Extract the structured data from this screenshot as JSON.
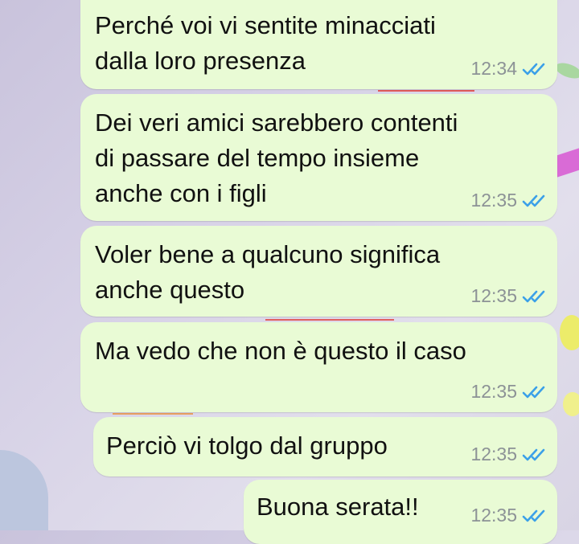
{
  "colors": {
    "bubble_outgoing": "#e9fbd5",
    "time_text": "#8c9296",
    "read_ticks": "#3ba0e8",
    "message_text": "#111111"
  },
  "messages": [
    {
      "text": "Perché voi vi sentite minacciati\ndalla loro presenza",
      "time": "12:34",
      "status_icon": "double-check-read-icon"
    },
    {
      "text": "Dei veri amici sarebbero contenti\ndi passare del tempo insieme\nanche con i figli",
      "time": "12:35",
      "status_icon": "double-check-read-icon"
    },
    {
      "text": "Voler bene a qualcuno significa\nanche questo",
      "time": "12:35",
      "status_icon": "double-check-read-icon"
    },
    {
      "text": "Ma vedo che non è questo il caso",
      "time": "12:35",
      "status_icon": "double-check-read-icon"
    },
    {
      "text": "Perciò vi tolgo dal gruppo",
      "time": "12:35",
      "status_icon": "double-check-read-icon"
    },
    {
      "text": "Buona serata!!",
      "time": "12:35",
      "status_icon": "double-check-read-icon"
    }
  ]
}
